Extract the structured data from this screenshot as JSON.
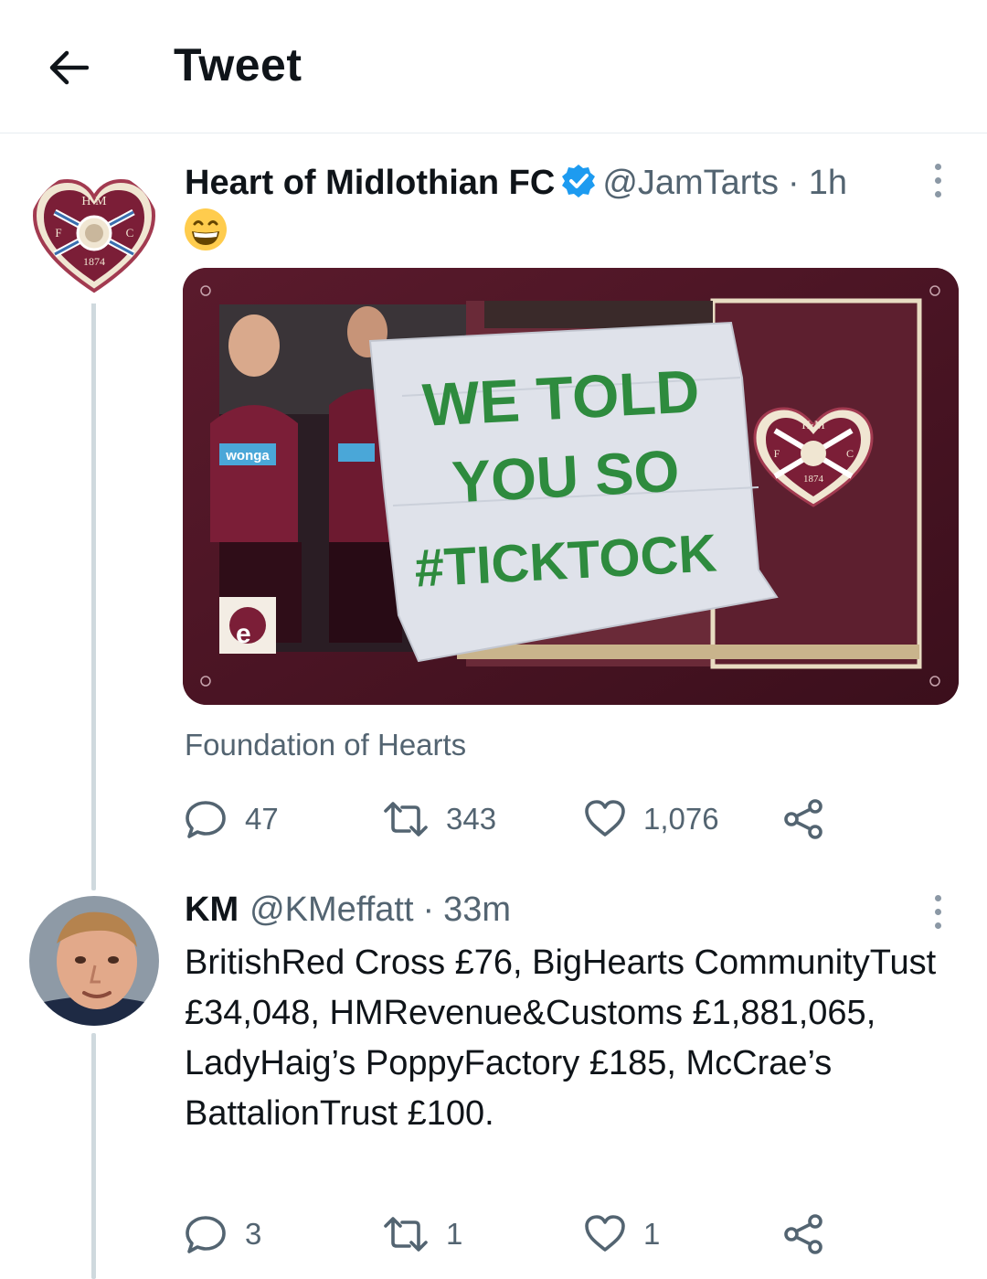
{
  "header": {
    "title": "Tweet",
    "back_icon": "arrow-left-icon"
  },
  "tweet1": {
    "name": "Heart of Midlothian FC",
    "handle": "@JamTarts",
    "separator": "·",
    "time": "1h",
    "emoji": "😄",
    "media": {
      "banner_line1": "WE TOLD",
      "banner_line2": "YOU SO",
      "banner_line3": "#TICKTOCK",
      "crest_line1": "H·M",
      "crest_line2": "F",
      "crest_line3": "C",
      "crest_year": "1874",
      "shirt_sponsor": "wonga"
    },
    "caption": "Foundation of Hearts",
    "replies": "47",
    "retweets": "343",
    "likes": "1,076",
    "logo": {
      "top": "H·M",
      "left": "F",
      "right": "C",
      "year": "1874"
    }
  },
  "tweet2": {
    "name": "KM",
    "handle": "@KMeffatt",
    "separator": "·",
    "time": "33m",
    "text": "BritishRed Cross £76, BigHearts CommunityTust £34,048, HMRevenue&Customs £1,881,065, LadyHaig’s PoppyFactory £185, McCrae’s BattalionTrust £100.",
    "replies": "3",
    "retweets": "1",
    "likes": "1"
  },
  "colors": {
    "accent": "#1d9bf0",
    "secondary_text": "#536471",
    "maroon": "#7b1e37",
    "banner_green": "#2e8b3e"
  }
}
